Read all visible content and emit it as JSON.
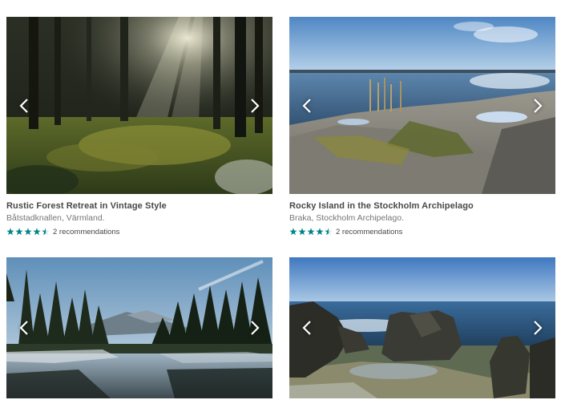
{
  "colors": {
    "star": "#008489",
    "title": "#484848",
    "subtitle": "#767676"
  },
  "listings": [
    {
      "title": "Rustic Forest Retreat in Vintage Style",
      "location": "Båtstadknallen, Värmland.",
      "rating": 4.5,
      "recommendations": "2 recommendations",
      "image": "forest-sunbeams-photo"
    },
    {
      "title": "Rocky Island in the Stockholm Archipelago",
      "location": "Braka, Stockholm Archipelago.",
      "rating": 4.5,
      "recommendations": "2 recommendations",
      "image": "rocky-shore-lake-photo"
    },
    {
      "image": "mountain-river-forest-photo"
    },
    {
      "image": "sea-rock-formations-photo"
    }
  ],
  "icons": {
    "prev": "chevron-left-icon",
    "next": "chevron-right-icon",
    "star": "star-icon"
  }
}
